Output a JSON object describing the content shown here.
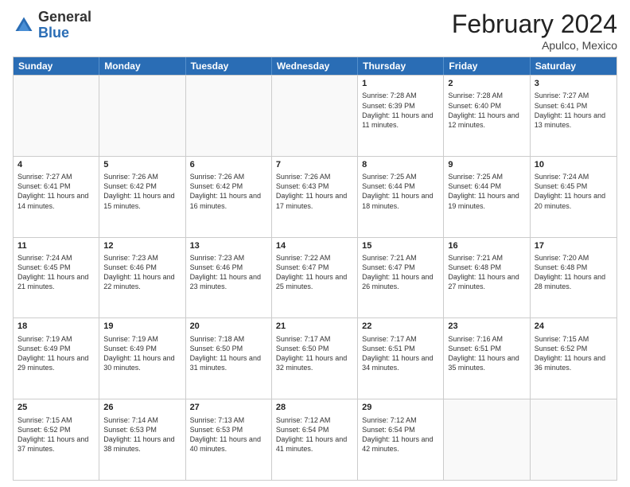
{
  "header": {
    "logo_general": "General",
    "logo_blue": "Blue",
    "month_title": "February 2024",
    "location": "Apulco, Mexico"
  },
  "weekdays": [
    "Sunday",
    "Monday",
    "Tuesday",
    "Wednesday",
    "Thursday",
    "Friday",
    "Saturday"
  ],
  "rows": [
    [
      {
        "day": "",
        "info": ""
      },
      {
        "day": "",
        "info": ""
      },
      {
        "day": "",
        "info": ""
      },
      {
        "day": "",
        "info": ""
      },
      {
        "day": "1",
        "info": "Sunrise: 7:28 AM\nSunset: 6:39 PM\nDaylight: 11 hours and 11 minutes."
      },
      {
        "day": "2",
        "info": "Sunrise: 7:28 AM\nSunset: 6:40 PM\nDaylight: 11 hours and 12 minutes."
      },
      {
        "day": "3",
        "info": "Sunrise: 7:27 AM\nSunset: 6:41 PM\nDaylight: 11 hours and 13 minutes."
      }
    ],
    [
      {
        "day": "4",
        "info": "Sunrise: 7:27 AM\nSunset: 6:41 PM\nDaylight: 11 hours and 14 minutes."
      },
      {
        "day": "5",
        "info": "Sunrise: 7:26 AM\nSunset: 6:42 PM\nDaylight: 11 hours and 15 minutes."
      },
      {
        "day": "6",
        "info": "Sunrise: 7:26 AM\nSunset: 6:42 PM\nDaylight: 11 hours and 16 minutes."
      },
      {
        "day": "7",
        "info": "Sunrise: 7:26 AM\nSunset: 6:43 PM\nDaylight: 11 hours and 17 minutes."
      },
      {
        "day": "8",
        "info": "Sunrise: 7:25 AM\nSunset: 6:44 PM\nDaylight: 11 hours and 18 minutes."
      },
      {
        "day": "9",
        "info": "Sunrise: 7:25 AM\nSunset: 6:44 PM\nDaylight: 11 hours and 19 minutes."
      },
      {
        "day": "10",
        "info": "Sunrise: 7:24 AM\nSunset: 6:45 PM\nDaylight: 11 hours and 20 minutes."
      }
    ],
    [
      {
        "day": "11",
        "info": "Sunrise: 7:24 AM\nSunset: 6:45 PM\nDaylight: 11 hours and 21 minutes."
      },
      {
        "day": "12",
        "info": "Sunrise: 7:23 AM\nSunset: 6:46 PM\nDaylight: 11 hours and 22 minutes."
      },
      {
        "day": "13",
        "info": "Sunrise: 7:23 AM\nSunset: 6:46 PM\nDaylight: 11 hours and 23 minutes."
      },
      {
        "day": "14",
        "info": "Sunrise: 7:22 AM\nSunset: 6:47 PM\nDaylight: 11 hours and 25 minutes."
      },
      {
        "day": "15",
        "info": "Sunrise: 7:21 AM\nSunset: 6:47 PM\nDaylight: 11 hours and 26 minutes."
      },
      {
        "day": "16",
        "info": "Sunrise: 7:21 AM\nSunset: 6:48 PM\nDaylight: 11 hours and 27 minutes."
      },
      {
        "day": "17",
        "info": "Sunrise: 7:20 AM\nSunset: 6:48 PM\nDaylight: 11 hours and 28 minutes."
      }
    ],
    [
      {
        "day": "18",
        "info": "Sunrise: 7:19 AM\nSunset: 6:49 PM\nDaylight: 11 hours and 29 minutes."
      },
      {
        "day": "19",
        "info": "Sunrise: 7:19 AM\nSunset: 6:49 PM\nDaylight: 11 hours and 30 minutes."
      },
      {
        "day": "20",
        "info": "Sunrise: 7:18 AM\nSunset: 6:50 PM\nDaylight: 11 hours and 31 minutes."
      },
      {
        "day": "21",
        "info": "Sunrise: 7:17 AM\nSunset: 6:50 PM\nDaylight: 11 hours and 32 minutes."
      },
      {
        "day": "22",
        "info": "Sunrise: 7:17 AM\nSunset: 6:51 PM\nDaylight: 11 hours and 34 minutes."
      },
      {
        "day": "23",
        "info": "Sunrise: 7:16 AM\nSunset: 6:51 PM\nDaylight: 11 hours and 35 minutes."
      },
      {
        "day": "24",
        "info": "Sunrise: 7:15 AM\nSunset: 6:52 PM\nDaylight: 11 hours and 36 minutes."
      }
    ],
    [
      {
        "day": "25",
        "info": "Sunrise: 7:15 AM\nSunset: 6:52 PM\nDaylight: 11 hours and 37 minutes."
      },
      {
        "day": "26",
        "info": "Sunrise: 7:14 AM\nSunset: 6:53 PM\nDaylight: 11 hours and 38 minutes."
      },
      {
        "day": "27",
        "info": "Sunrise: 7:13 AM\nSunset: 6:53 PM\nDaylight: 11 hours and 40 minutes."
      },
      {
        "day": "28",
        "info": "Sunrise: 7:12 AM\nSunset: 6:54 PM\nDaylight: 11 hours and 41 minutes."
      },
      {
        "day": "29",
        "info": "Sunrise: 7:12 AM\nSunset: 6:54 PM\nDaylight: 11 hours and 42 minutes."
      },
      {
        "day": "",
        "info": ""
      },
      {
        "day": "",
        "info": ""
      }
    ]
  ]
}
